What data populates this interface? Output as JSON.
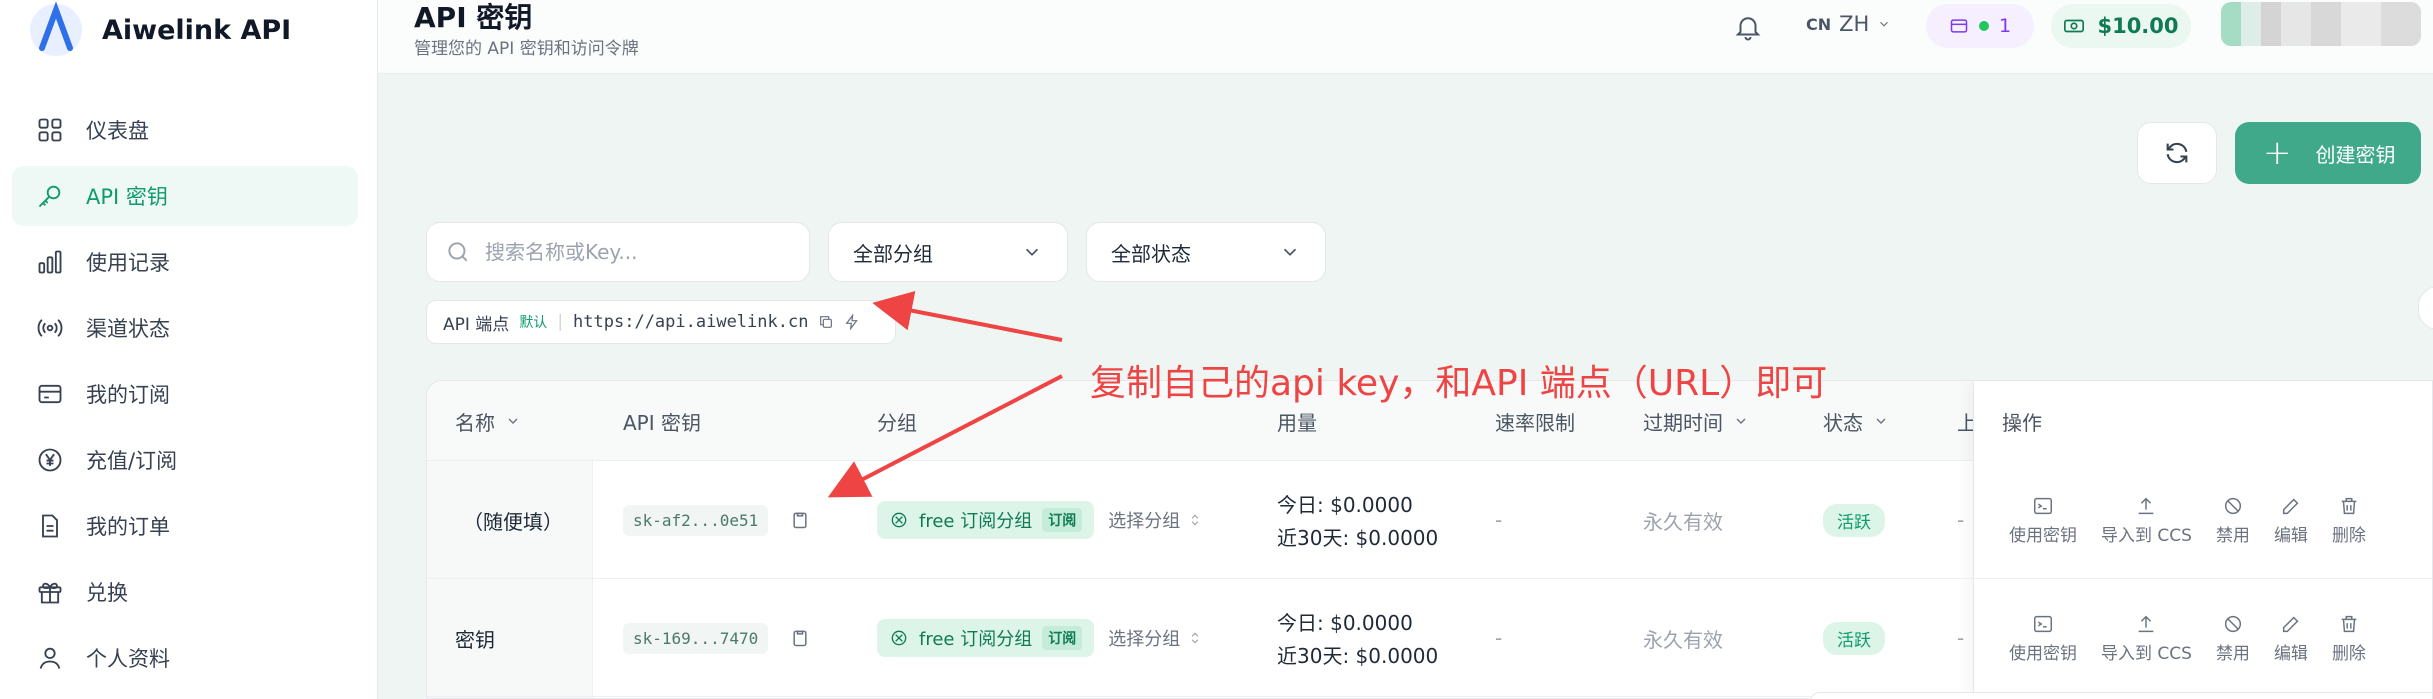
{
  "app": {
    "name": "Aiwelink API",
    "accent": "#3fa98a"
  },
  "sidebar": {
    "items": [
      {
        "label": "仪表盘",
        "icon": "dashboard-icon"
      },
      {
        "label": "API 密钥",
        "icon": "key-icon",
        "active": true
      },
      {
        "label": "使用记录",
        "icon": "chart-icon"
      },
      {
        "label": "渠道状态",
        "icon": "signal-icon"
      },
      {
        "label": "我的订阅",
        "icon": "card-icon"
      },
      {
        "label": "充值/订阅",
        "icon": "yen-icon"
      },
      {
        "label": "我的订单",
        "icon": "document-icon"
      },
      {
        "label": "兑换",
        "icon": "gift-icon"
      },
      {
        "label": "个人资料",
        "icon": "user-icon"
      }
    ]
  },
  "header": {
    "title": "API 密钥",
    "subtitle": "管理您的 API 密钥和访问令牌",
    "lang_flag": "CN",
    "lang": "ZH",
    "subscriptions": "1",
    "balance": "$10.00"
  },
  "toolbar": {
    "create_label": "创建密钥"
  },
  "filters": {
    "search_placeholder": "搜索名称或Key...",
    "group": "全部分组",
    "status": "全部状态"
  },
  "endpoint": {
    "label": "API 端点",
    "tag": "默认",
    "url": "https://api.aiwelink.cn"
  },
  "table": {
    "headers": [
      "名称",
      "API 密钥",
      "分组",
      "用量",
      "速率限制",
      "过期时间",
      "状态",
      "上",
      "操作"
    ],
    "rows": [
      {
        "name": "（随便填）",
        "key": "sk-af2...0e51",
        "group": "free 订阅分组",
        "group_tag": "订阅",
        "choose": "选择分组",
        "today": "今日:",
        "today_val": "$0.0000",
        "month": "近30天:",
        "month_val": "$0.0000",
        "rate": "-",
        "expire": "永久有效",
        "status": "活跃",
        "last": "-"
      },
      {
        "name": "密钥",
        "key": "sk-169...7470",
        "group": "free 订阅分组",
        "group_tag": "订阅",
        "choose": "选择分组",
        "today": "今日:",
        "today_val": "$0.0000",
        "month": "近30天:",
        "month_val": "$0.0000",
        "rate": "-",
        "expire": "永久有效",
        "status": "活跃",
        "last": "-"
      }
    ],
    "ops": [
      "使用密钥",
      "导入到 CCS",
      "禁用",
      "编辑",
      "删除"
    ]
  },
  "annotation": {
    "text": "复制自己的api key，和API 端点（URL）即可",
    "color": "#ef4444"
  }
}
